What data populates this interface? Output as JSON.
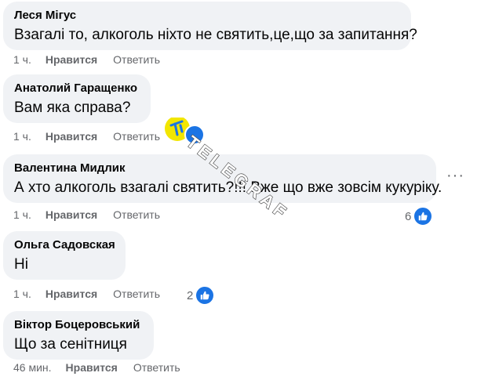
{
  "comments": [
    {
      "author": "Леся Мігус",
      "text": "Взагалі то, алкоголь ніхто не святить,це,що за запитання?",
      "time": "1 ч.",
      "like_label": "Нравится",
      "reply_label": "Ответить",
      "reactions": ""
    },
    {
      "author": "Анатолий Гаращенко",
      "text": "Вам яка справа?",
      "time": "1 ч.",
      "like_label": "Нравится",
      "reply_label": "Ответить",
      "reactions": ""
    },
    {
      "author": "Валентина Мидлик",
      "text": "А хто алкоголь взагалі святить?!!! Вже що вже зовсім кукуріку.",
      "time": "1 ч.",
      "like_label": "Нравится",
      "reply_label": "Ответить",
      "reactions": "6"
    },
    {
      "author": "Ольга Садовская",
      "text": "Ні",
      "time": "1 ч.",
      "like_label": "Нравится",
      "reply_label": "Ответить",
      "reactions": "2"
    },
    {
      "author": "Віктор Боцеровський",
      "text": "Що за сенітниця",
      "time": "46 мин.",
      "like_label": "Нравится",
      "reply_label": "Ответить",
      "reactions": ""
    }
  ],
  "watermark": {
    "text": "TELEGRAF"
  },
  "colors": {
    "bubble": "#f0f2f5",
    "meta": "#65676b",
    "like_blue": "#1b74e4",
    "watermark_yellow": "#f2e600"
  }
}
